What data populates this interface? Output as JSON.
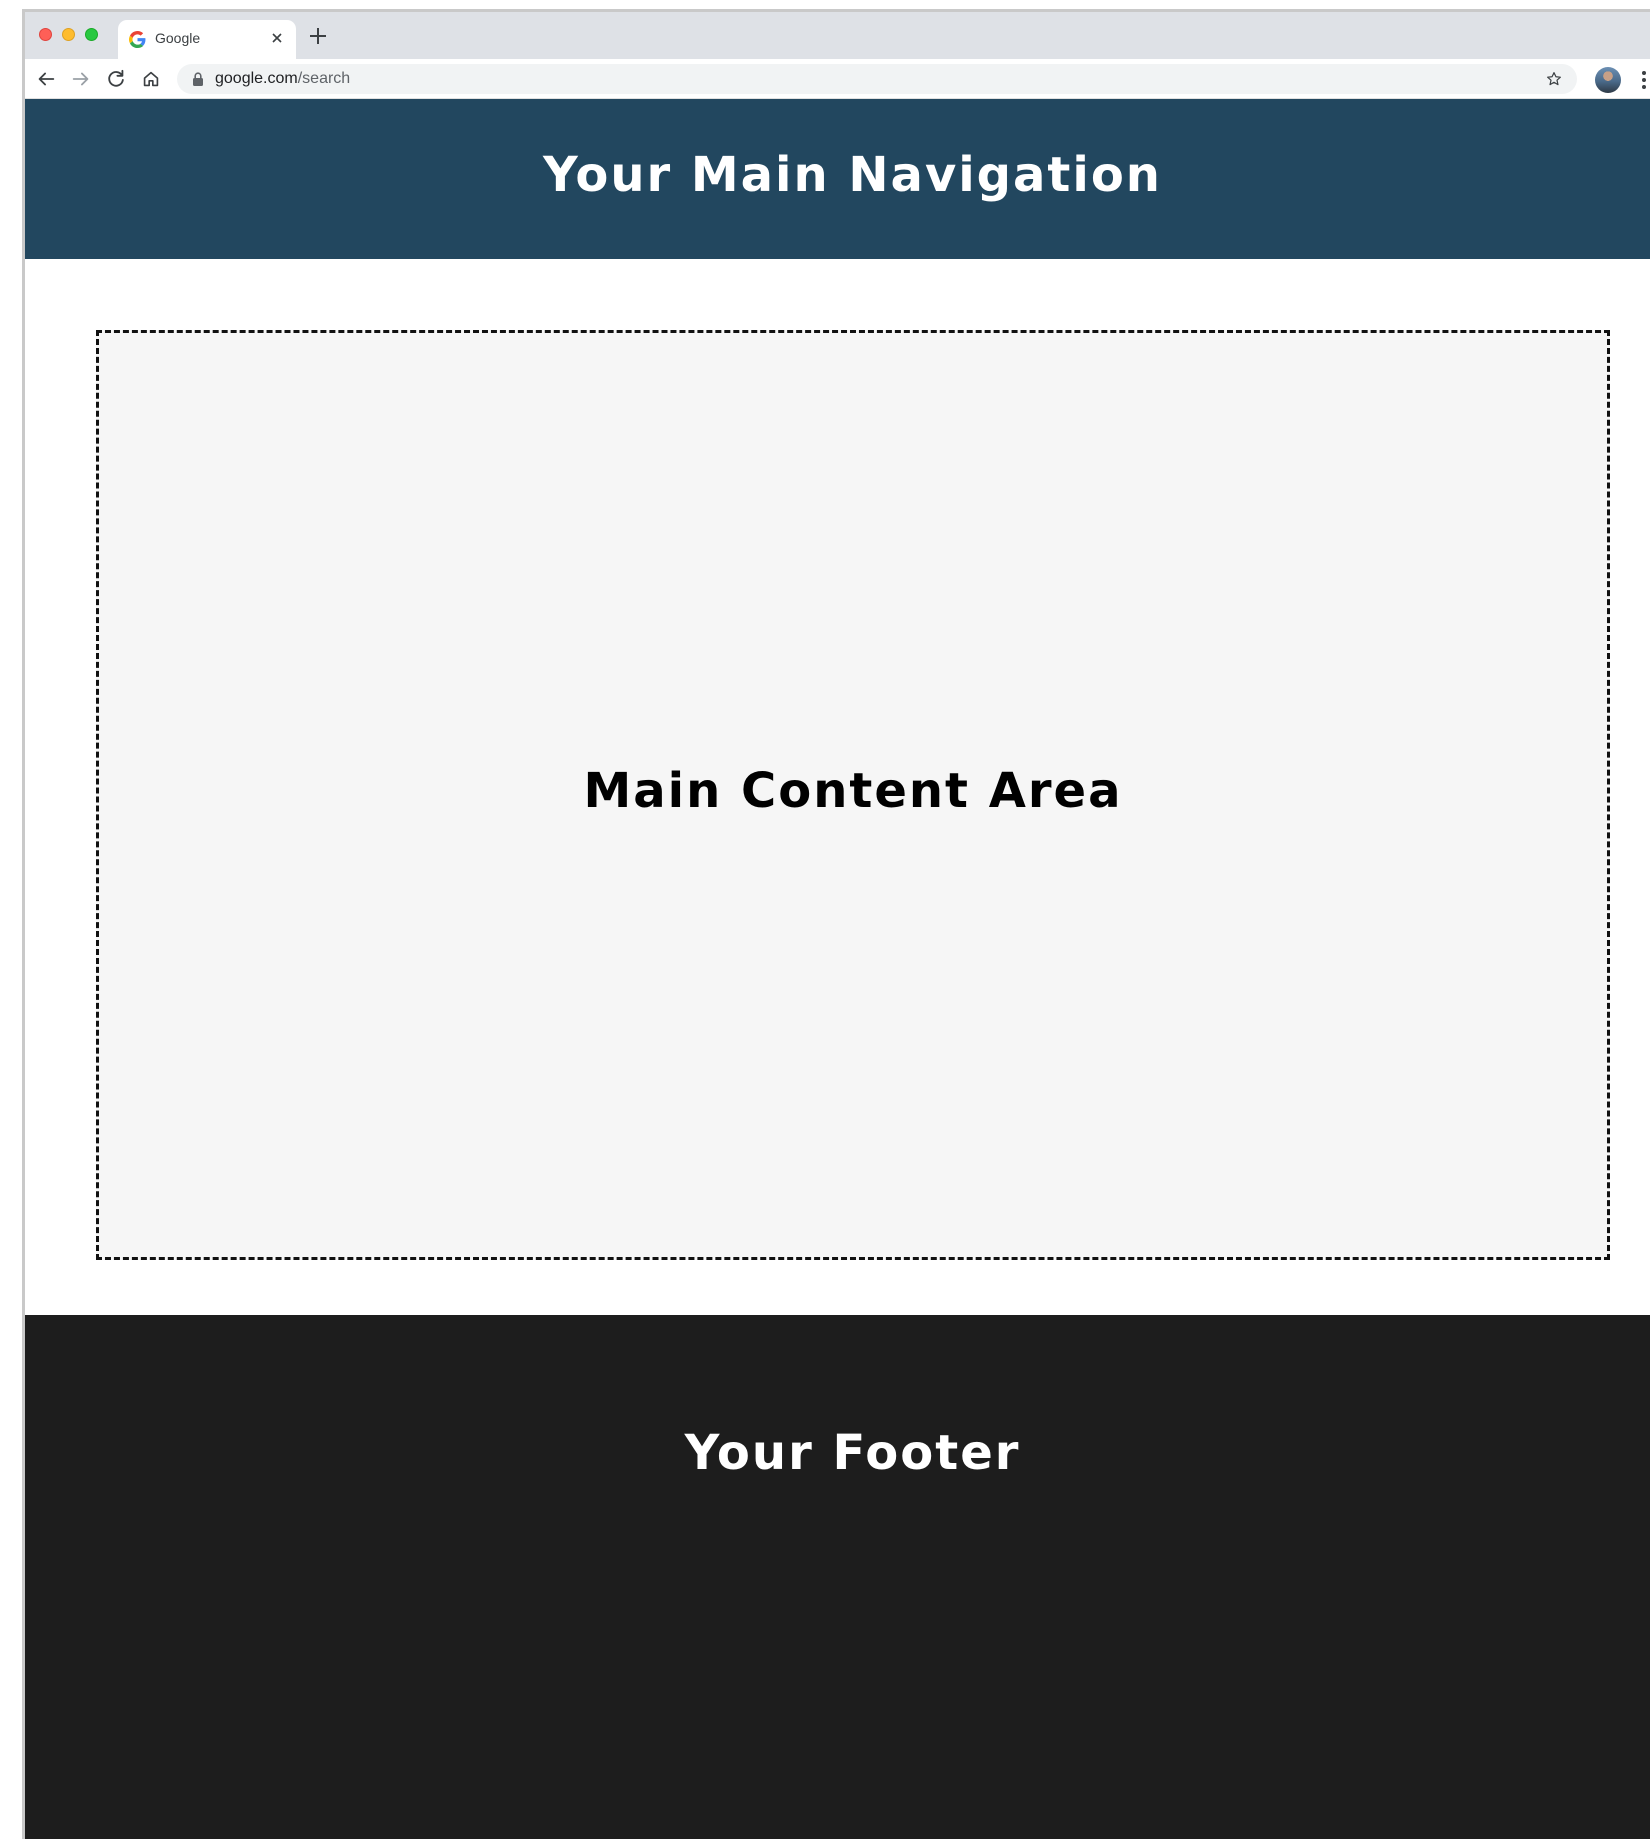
{
  "browser": {
    "tab": {
      "title": "Google",
      "favicon": "google-g-icon"
    },
    "omnibox": {
      "domain": "google.com",
      "path": "/search"
    },
    "icons": {
      "back": "arrow-left-icon",
      "forward": "arrow-right-icon",
      "reload": "reload-icon",
      "home": "home-icon",
      "lock": "lock-icon",
      "bookmark": "star-icon",
      "menu": "kebab-menu-icon",
      "new_tab": "plus-icon",
      "close_tab": "close-icon"
    }
  },
  "page": {
    "nav": {
      "title": "Your Main Navigation",
      "background": "#22475f"
    },
    "main": {
      "title": "Main Content Area",
      "background": "#f6f6f6"
    },
    "footer": {
      "title": "Your Footer",
      "background": "#1d1d1d"
    }
  }
}
